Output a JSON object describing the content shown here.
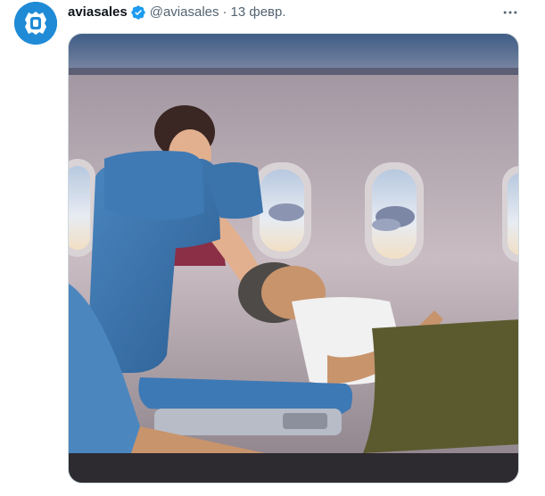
{
  "tweet": {
    "author_name": "aviasales",
    "handle": "@aviasales",
    "separator": "·",
    "date": "13 февр.",
    "verified": true,
    "media_description_icon": "airplane-cabin-illustration"
  },
  "colors": {
    "avatar_bg": "#1f8bd6",
    "verified_blue": "#1d9bf0",
    "secondary_text": "#536471",
    "primary_text": "#0f1419"
  }
}
